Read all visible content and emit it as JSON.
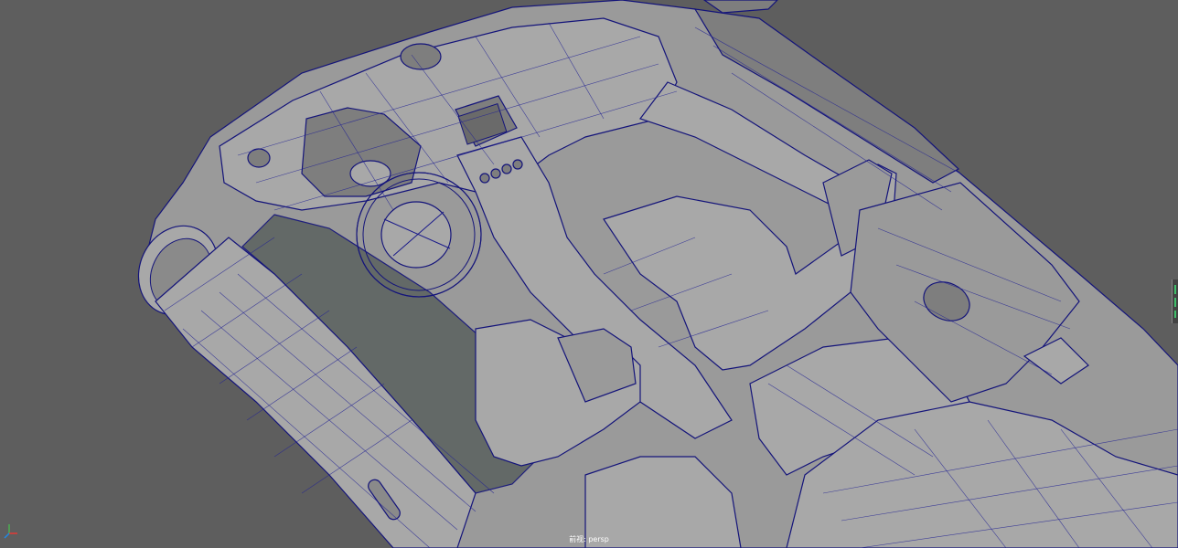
{
  "viewport": {
    "camera_label": "前视: persp"
  },
  "axis_gizmo": {
    "x_label": "x",
    "y_label": "y",
    "z_label": "z"
  },
  "colors": {
    "background": "#5e5e5e",
    "wireframe": "#14147a",
    "surface": "#9a9a9a",
    "glass": "#5f6563"
  },
  "icons": [
    "axis-gizmo-icon"
  ]
}
